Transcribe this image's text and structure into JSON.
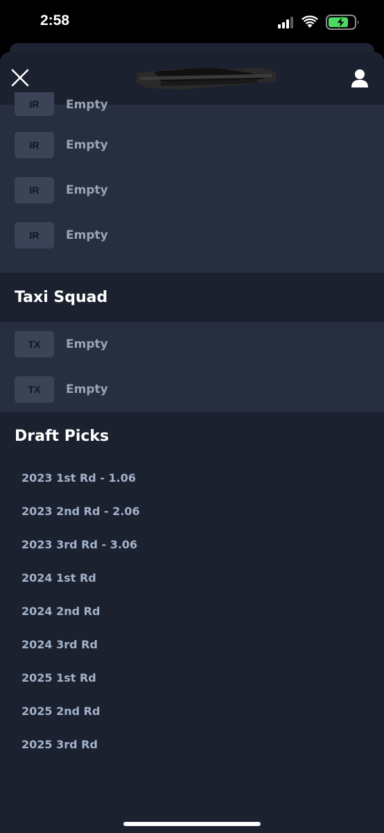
{
  "status_bar": {
    "time": "2:58",
    "battery_state": "charging",
    "icons": [
      "signal-icon",
      "wifi-icon",
      "battery-charging-icon"
    ]
  },
  "header": {
    "close_icon": "close-icon",
    "title_redacted": true,
    "profile_icon": "user-icon"
  },
  "ir": {
    "rows": [
      {
        "badge": "IR",
        "label": "Empty"
      },
      {
        "badge": "IR",
        "label": "Empty"
      },
      {
        "badge": "IR",
        "label": "Empty"
      },
      {
        "badge": "IR",
        "label": "Empty"
      }
    ]
  },
  "taxi_squad": {
    "title": "Taxi Squad",
    "rows": [
      {
        "badge": "TX",
        "label": "Empty"
      },
      {
        "badge": "TX",
        "label": "Empty"
      }
    ]
  },
  "draft_picks": {
    "title": "Draft Picks",
    "items": [
      "2023 1st Rd - 1.06",
      "2023 2nd Rd - 2.06",
      "2023 3rd Rd - 3.06",
      "2024 1st Rd",
      "2024 2nd Rd",
      "2024 3rd Rd",
      "2025 1st Rd",
      "2025 2nd Rd",
      "2025 3rd Rd"
    ]
  },
  "colors": {
    "background": "#1c2130",
    "row_background": "#272e40",
    "badge_background": "#3b4356",
    "row_text": "#9aa3b6",
    "pick_text": "#a3b3c9",
    "heading_text": "#ffffff",
    "battery_charging": "#4cd964"
  }
}
